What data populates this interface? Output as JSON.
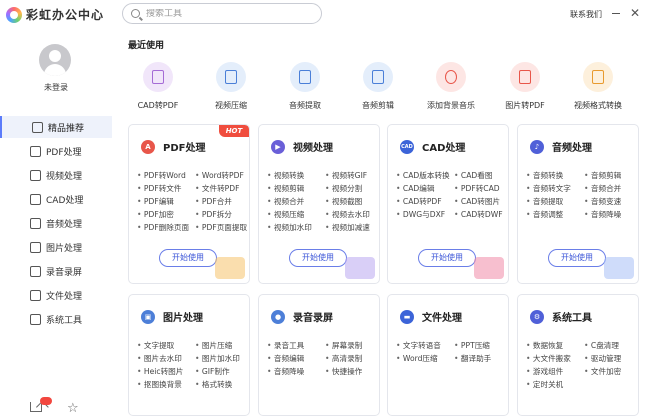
{
  "app": {
    "title": "彩虹办公中心",
    "logo_icon": "rainbow-logo-icon"
  },
  "search": {
    "placeholder": "搜索工具"
  },
  "header": {
    "contact": "联系我们"
  },
  "user": {
    "login_text": "未登录"
  },
  "sidebar": {
    "items": [
      {
        "label": "精品推荐",
        "icon": "thumbs-up-icon",
        "active": true
      },
      {
        "label": "PDF处理",
        "icon": "pdf-icon"
      },
      {
        "label": "视频处理",
        "icon": "video-icon"
      },
      {
        "label": "CAD处理",
        "icon": "cad-icon"
      },
      {
        "label": "音频处理",
        "icon": "audio-icon"
      },
      {
        "label": "图片处理",
        "icon": "image-icon"
      },
      {
        "label": "录音录屏",
        "icon": "record-icon"
      },
      {
        "label": "文件处理",
        "icon": "folder-icon"
      },
      {
        "label": "系统工具",
        "icon": "monitor-icon"
      }
    ]
  },
  "recent": {
    "title": "最近使用",
    "items": [
      {
        "label": "CAD转PDF",
        "color": "#a56bd6",
        "bg": "#f1e6fa"
      },
      {
        "label": "视频压缩",
        "color": "#4a7fd8",
        "bg": "#e4eefb"
      },
      {
        "label": "音频提取",
        "color": "#4a7fd8",
        "bg": "#e4eefb"
      },
      {
        "label": "音频剪辑",
        "color": "#4a7fd8",
        "bg": "#e4eefb"
      },
      {
        "label": "添加背景音乐",
        "color": "#e8564a",
        "bg": "#fde6e4"
      },
      {
        "label": "图片转PDF",
        "color": "#e8564a",
        "bg": "#fde6e4"
      },
      {
        "label": "视频格式转换",
        "color": "#e89a2e",
        "bg": "#fdf0dc"
      }
    ]
  },
  "cards": [
    {
      "title": "PDF处理",
      "hot": "HOT",
      "icon_color": "#e8564a",
      "icon_glyph": "A",
      "features": [
        "PDF转Word",
        "Word转PDF",
        "PDF转文件",
        "文件转PDF",
        "PDF编辑",
        "PDF合并",
        "PDF加密",
        "PDF拆分",
        "PDF删除页面",
        "PDF页面提取"
      ],
      "button": "开始使用",
      "deco": "#f5c26b"
    },
    {
      "title": "视频处理",
      "icon_color": "#6a5fd8",
      "icon_glyph": "▶",
      "features": [
        "视频转换",
        "视频转GIF",
        "视频剪辑",
        "视频分割",
        "视频合并",
        "视频截图",
        "视频压缩",
        "视频去水印",
        "视频加水印",
        "视频加减速"
      ],
      "button": "开始使用",
      "deco": "#b9a8f0"
    },
    {
      "title": "CAD处理",
      "icon_color": "#3c64d8",
      "icon_glyph": "CAD",
      "features": [
        "CAD版本转换",
        "CAD看图",
        "CAD编辑",
        "PDF转CAD",
        "CAD转PDF",
        "CAD转图片",
        "DWG与DXF",
        "CAD转DWF"
      ],
      "button": "开始使用",
      "deco": "#f08aa8"
    },
    {
      "title": "音频处理",
      "icon_color": "#5060d8",
      "icon_glyph": "♪",
      "features": [
        "音频转换",
        "音频剪辑",
        "音频转文字",
        "音频合并",
        "音频提取",
        "音频变速",
        "音频调整",
        "音频降噪"
      ],
      "button": "开始使用",
      "deco": "#a8c0f5"
    },
    {
      "title": "图片处理",
      "icon_color": "#4d7fd8",
      "icon_glyph": "▣",
      "features": [
        "文字提取",
        "图片压缩",
        "图片去水印",
        "图片加水印",
        "Heic转图片",
        "GIF制作",
        "抠图换背景",
        "格式转换"
      ]
    },
    {
      "title": "录音录屏",
      "icon_color": "#4d7fd8",
      "icon_glyph": "●",
      "features": [
        "录音工具",
        "屏幕录制",
        "音频编辑",
        "高清录制",
        "音频降噪",
        "快捷操作"
      ]
    },
    {
      "title": "文件处理",
      "icon_color": "#3c64d8",
      "icon_glyph": "▬",
      "features": [
        "文字转语音",
        "PPT压缩",
        "Word压缩",
        "翻译助手"
      ]
    },
    {
      "title": "系统工具",
      "icon_color": "#5060d8",
      "icon_glyph": "⚙",
      "features": [
        "数据恢复",
        "C盘清理",
        "大文件搬家",
        "驱动管理",
        "游戏组件",
        "文件加密",
        "定时关机"
      ]
    }
  ]
}
